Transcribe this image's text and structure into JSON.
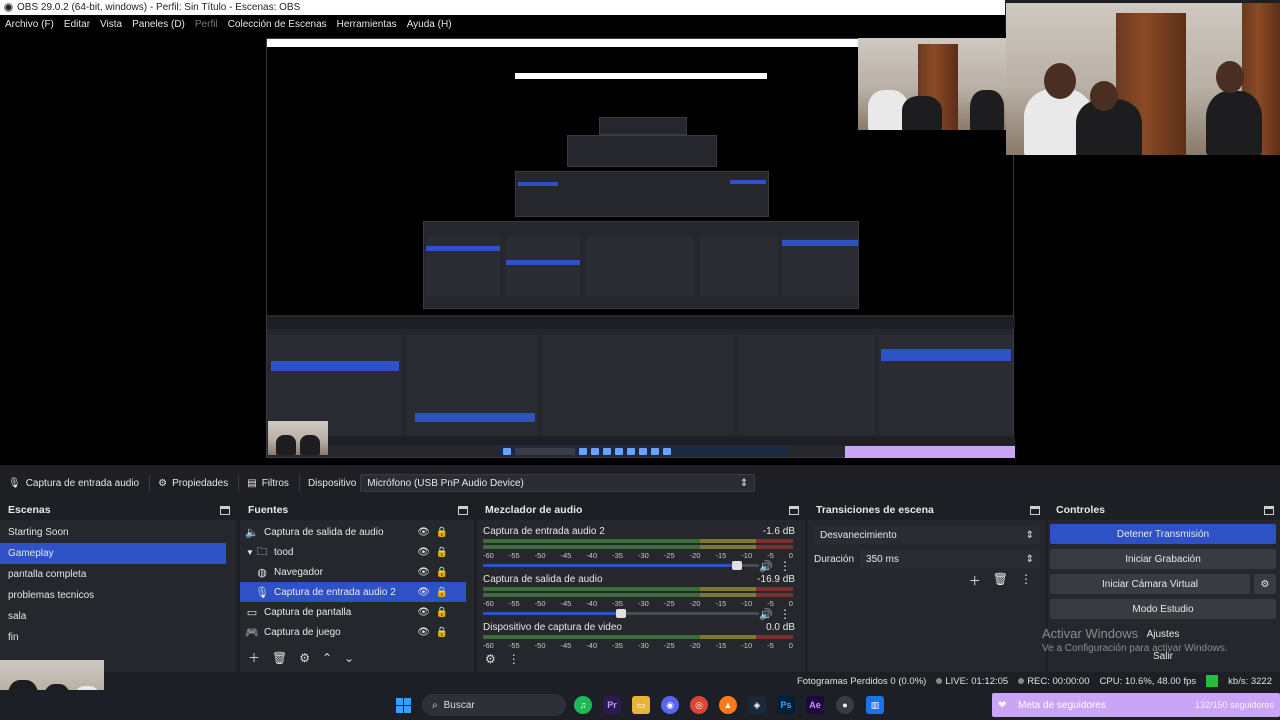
{
  "window": {
    "title": "OBS 29.0.2 (64-bit, windows) - Perfil: Sin Título - Escenas: OBS"
  },
  "menu": [
    {
      "label": "Archivo (F)",
      "enabled": true
    },
    {
      "label": "Editar",
      "enabled": true
    },
    {
      "label": "Vista",
      "enabled": true
    },
    {
      "label": "Paneles (D)",
      "enabled": true
    },
    {
      "label": "Perfil",
      "enabled": false
    },
    {
      "label": "Colección de Escenas",
      "enabled": true
    },
    {
      "label": "Herramientas",
      "enabled": true
    },
    {
      "label": "Ayuda (H)",
      "enabled": true
    }
  ],
  "source_bar": {
    "source_label": "Captura de entrada audio",
    "properties_label": "Propiedades",
    "filters_label": "Filtros",
    "device_label": "Dispositivo",
    "device_value": "Micrófono (USB PnP Audio Device)"
  },
  "scenes": {
    "title": "Escenas",
    "items": [
      {
        "label": "Starting Soon",
        "active": false
      },
      {
        "label": "Gameplay",
        "active": true
      },
      {
        "label": "pantalla completa",
        "active": false
      },
      {
        "label": "problemas tecnicos",
        "active": false
      },
      {
        "label": "sala",
        "active": false
      },
      {
        "label": "fin",
        "active": false
      }
    ]
  },
  "sources": {
    "title": "Fuentes",
    "items": [
      {
        "label": "Captura de salida de audio",
        "icon": "speaker-icon",
        "indent": 0,
        "active": false
      },
      {
        "label": "tood",
        "icon": "folder-icon",
        "indent": 0,
        "active": false,
        "group": true
      },
      {
        "label": "Navegador",
        "icon": "globe-icon",
        "indent": 1,
        "active": false
      },
      {
        "label": "Captura de entrada audio 2",
        "icon": "microphone-icon",
        "indent": 1,
        "active": true
      },
      {
        "label": "Captura de pantalla",
        "icon": "monitor-icon",
        "indent": 0,
        "active": false
      },
      {
        "label": "Captura de juego",
        "icon": "gamepad-icon",
        "indent": 0,
        "active": false
      }
    ]
  },
  "mixer": {
    "title": "Mezclador de audio",
    "ticks": [
      "-60",
      "-55",
      "-50",
      "-45",
      "-40",
      "-35",
      "-30",
      "-25",
      "-20",
      "-15",
      "-10",
      "-5",
      "0"
    ],
    "channels": [
      {
        "name": "Captura de entrada audio 2",
        "db": "-1.6 dB",
        "level": 0.92
      },
      {
        "name": "Captura de salida de audio",
        "db": "-16.9 dB",
        "level": 0.5
      },
      {
        "name": "Dispositivo de captura de video",
        "db": "0.0 dB",
        "level": null
      }
    ]
  },
  "transitions": {
    "title": "Transiciones de escena",
    "selected": "Desvanecimiento",
    "duration_label": "Duración",
    "duration_value": "350 ms"
  },
  "controls": {
    "title": "Controles",
    "buttons": [
      {
        "label": "Detener Transmisión",
        "primary": true
      },
      {
        "label": "Iniciar Grabación",
        "primary": false
      },
      {
        "label": "Iniciar Cámara Virtual",
        "primary": false
      },
      {
        "label": "Modo Estudio",
        "primary": false
      },
      {
        "label": "Ajustes",
        "primary": false
      },
      {
        "label": "Salir",
        "primary": false
      }
    ]
  },
  "status": {
    "dropped": "Fotogramas Perdidos 0 (0.0%)",
    "live": "LIVE: 01:12:05",
    "rec": "REC: 00:00:00",
    "cpu": "CPU: 10.6%, 48.00 fps",
    "kbps": "kb/s: 3222"
  },
  "activation": {
    "title": "Activar Windows",
    "subtitle": "Ve a Configuración para activar Windows."
  },
  "taskbar": {
    "search_placeholder": "Buscar",
    "followers_label": "Meta de seguidores",
    "followers_count": "132/150 seguidores"
  },
  "colors": {
    "accent": "#2e51c6",
    "panel": "#26272d",
    "bg": "#1e1f24",
    "ok": "#1fc13a"
  }
}
